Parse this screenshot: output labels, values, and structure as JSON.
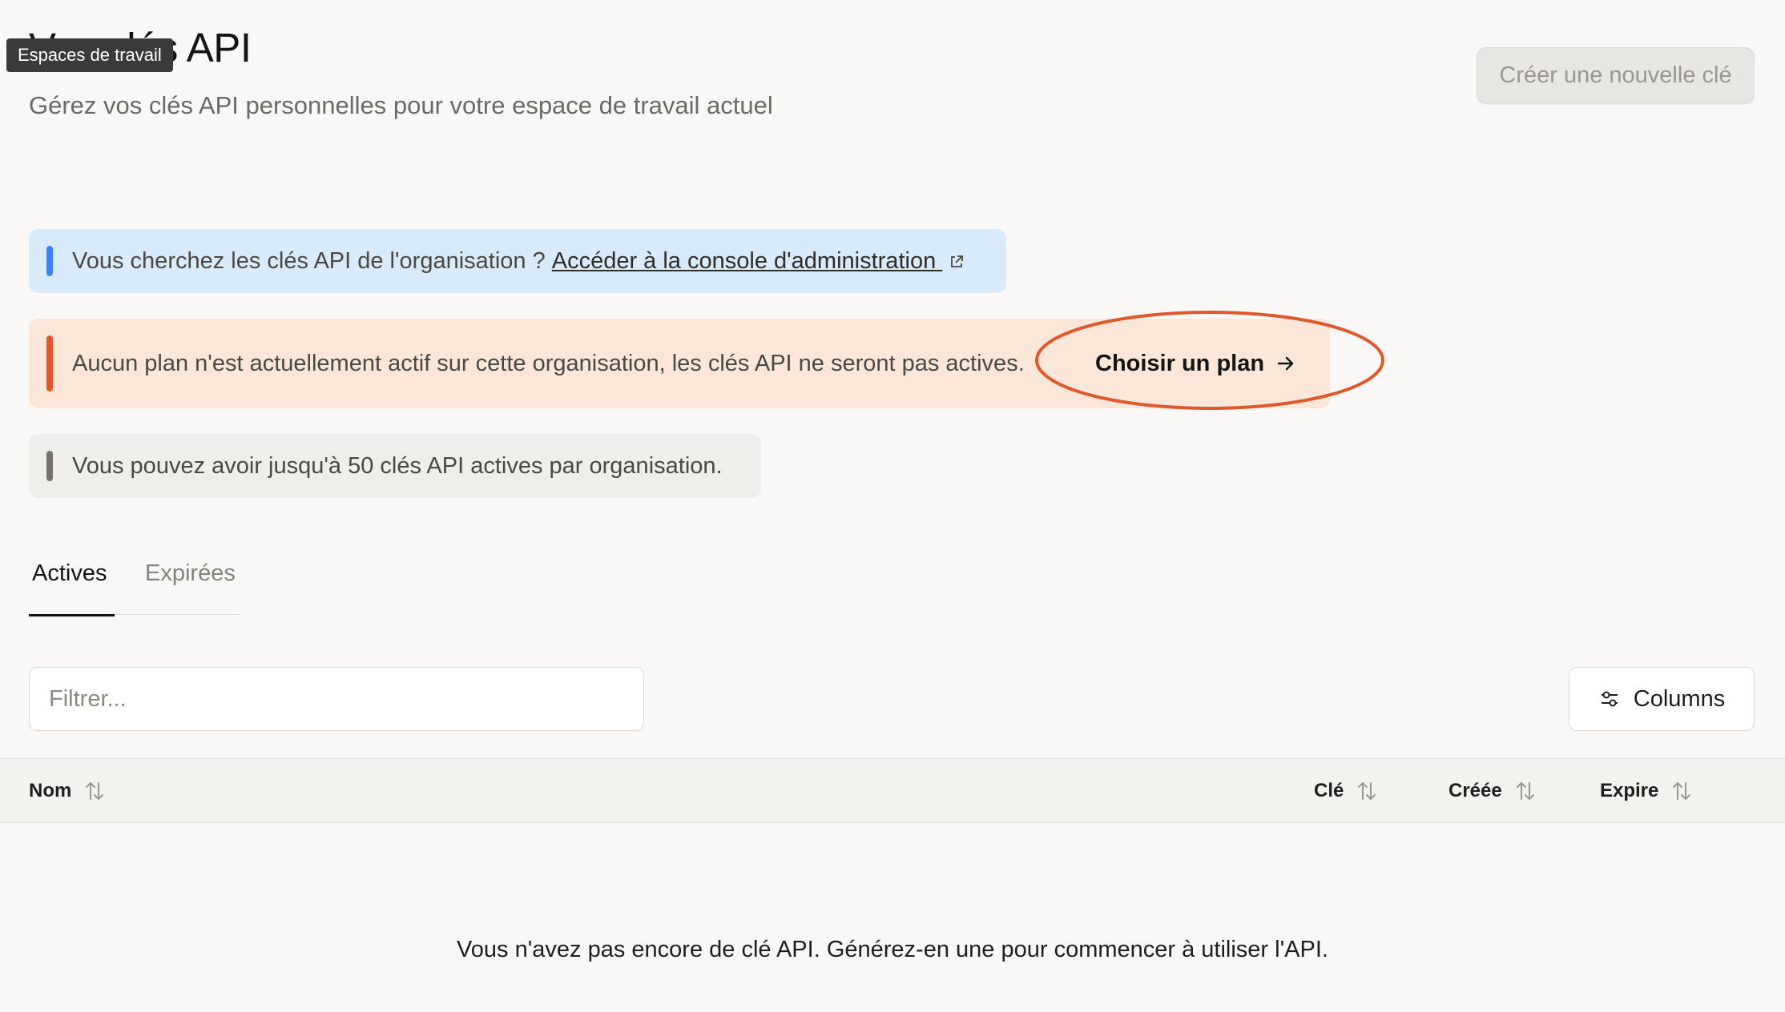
{
  "header": {
    "title": "Vos clés API",
    "subtitle": "Gérez vos clés API personnelles pour votre espace de travail actuel",
    "tooltip": "Espaces de travail",
    "create_button_label": "Créer une nouvelle clé"
  },
  "banners": {
    "info": {
      "text": "Vous cherchez les clés API de l'organisation ?",
      "link_label": "Accéder à la console d'administration",
      "accent_color": "#3b82f6"
    },
    "warning": {
      "text": "Aucun plan n'est actuellement actif sur cette organisation, les clés API ne seront pas actives.",
      "action_label": "Choisir un plan",
      "accent_color": "#e0592a"
    },
    "note": {
      "text": "Vous pouvez avoir jusqu'à 50 clés API actives par organisation.",
      "accent_color": "#77726c"
    }
  },
  "tabs": [
    {
      "label": "Actives",
      "active": true
    },
    {
      "label": "Expirées",
      "active": false
    }
  ],
  "filter": {
    "placeholder": "Filtrer..."
  },
  "columns_button_label": "Columns",
  "table": {
    "columns": [
      "Nom",
      "Clé",
      "Créée",
      "Expire"
    ],
    "rows": []
  },
  "empty_state": "Vous n'avez pas encore de clé API. Générez-en une pour commencer à utiliser l'API."
}
